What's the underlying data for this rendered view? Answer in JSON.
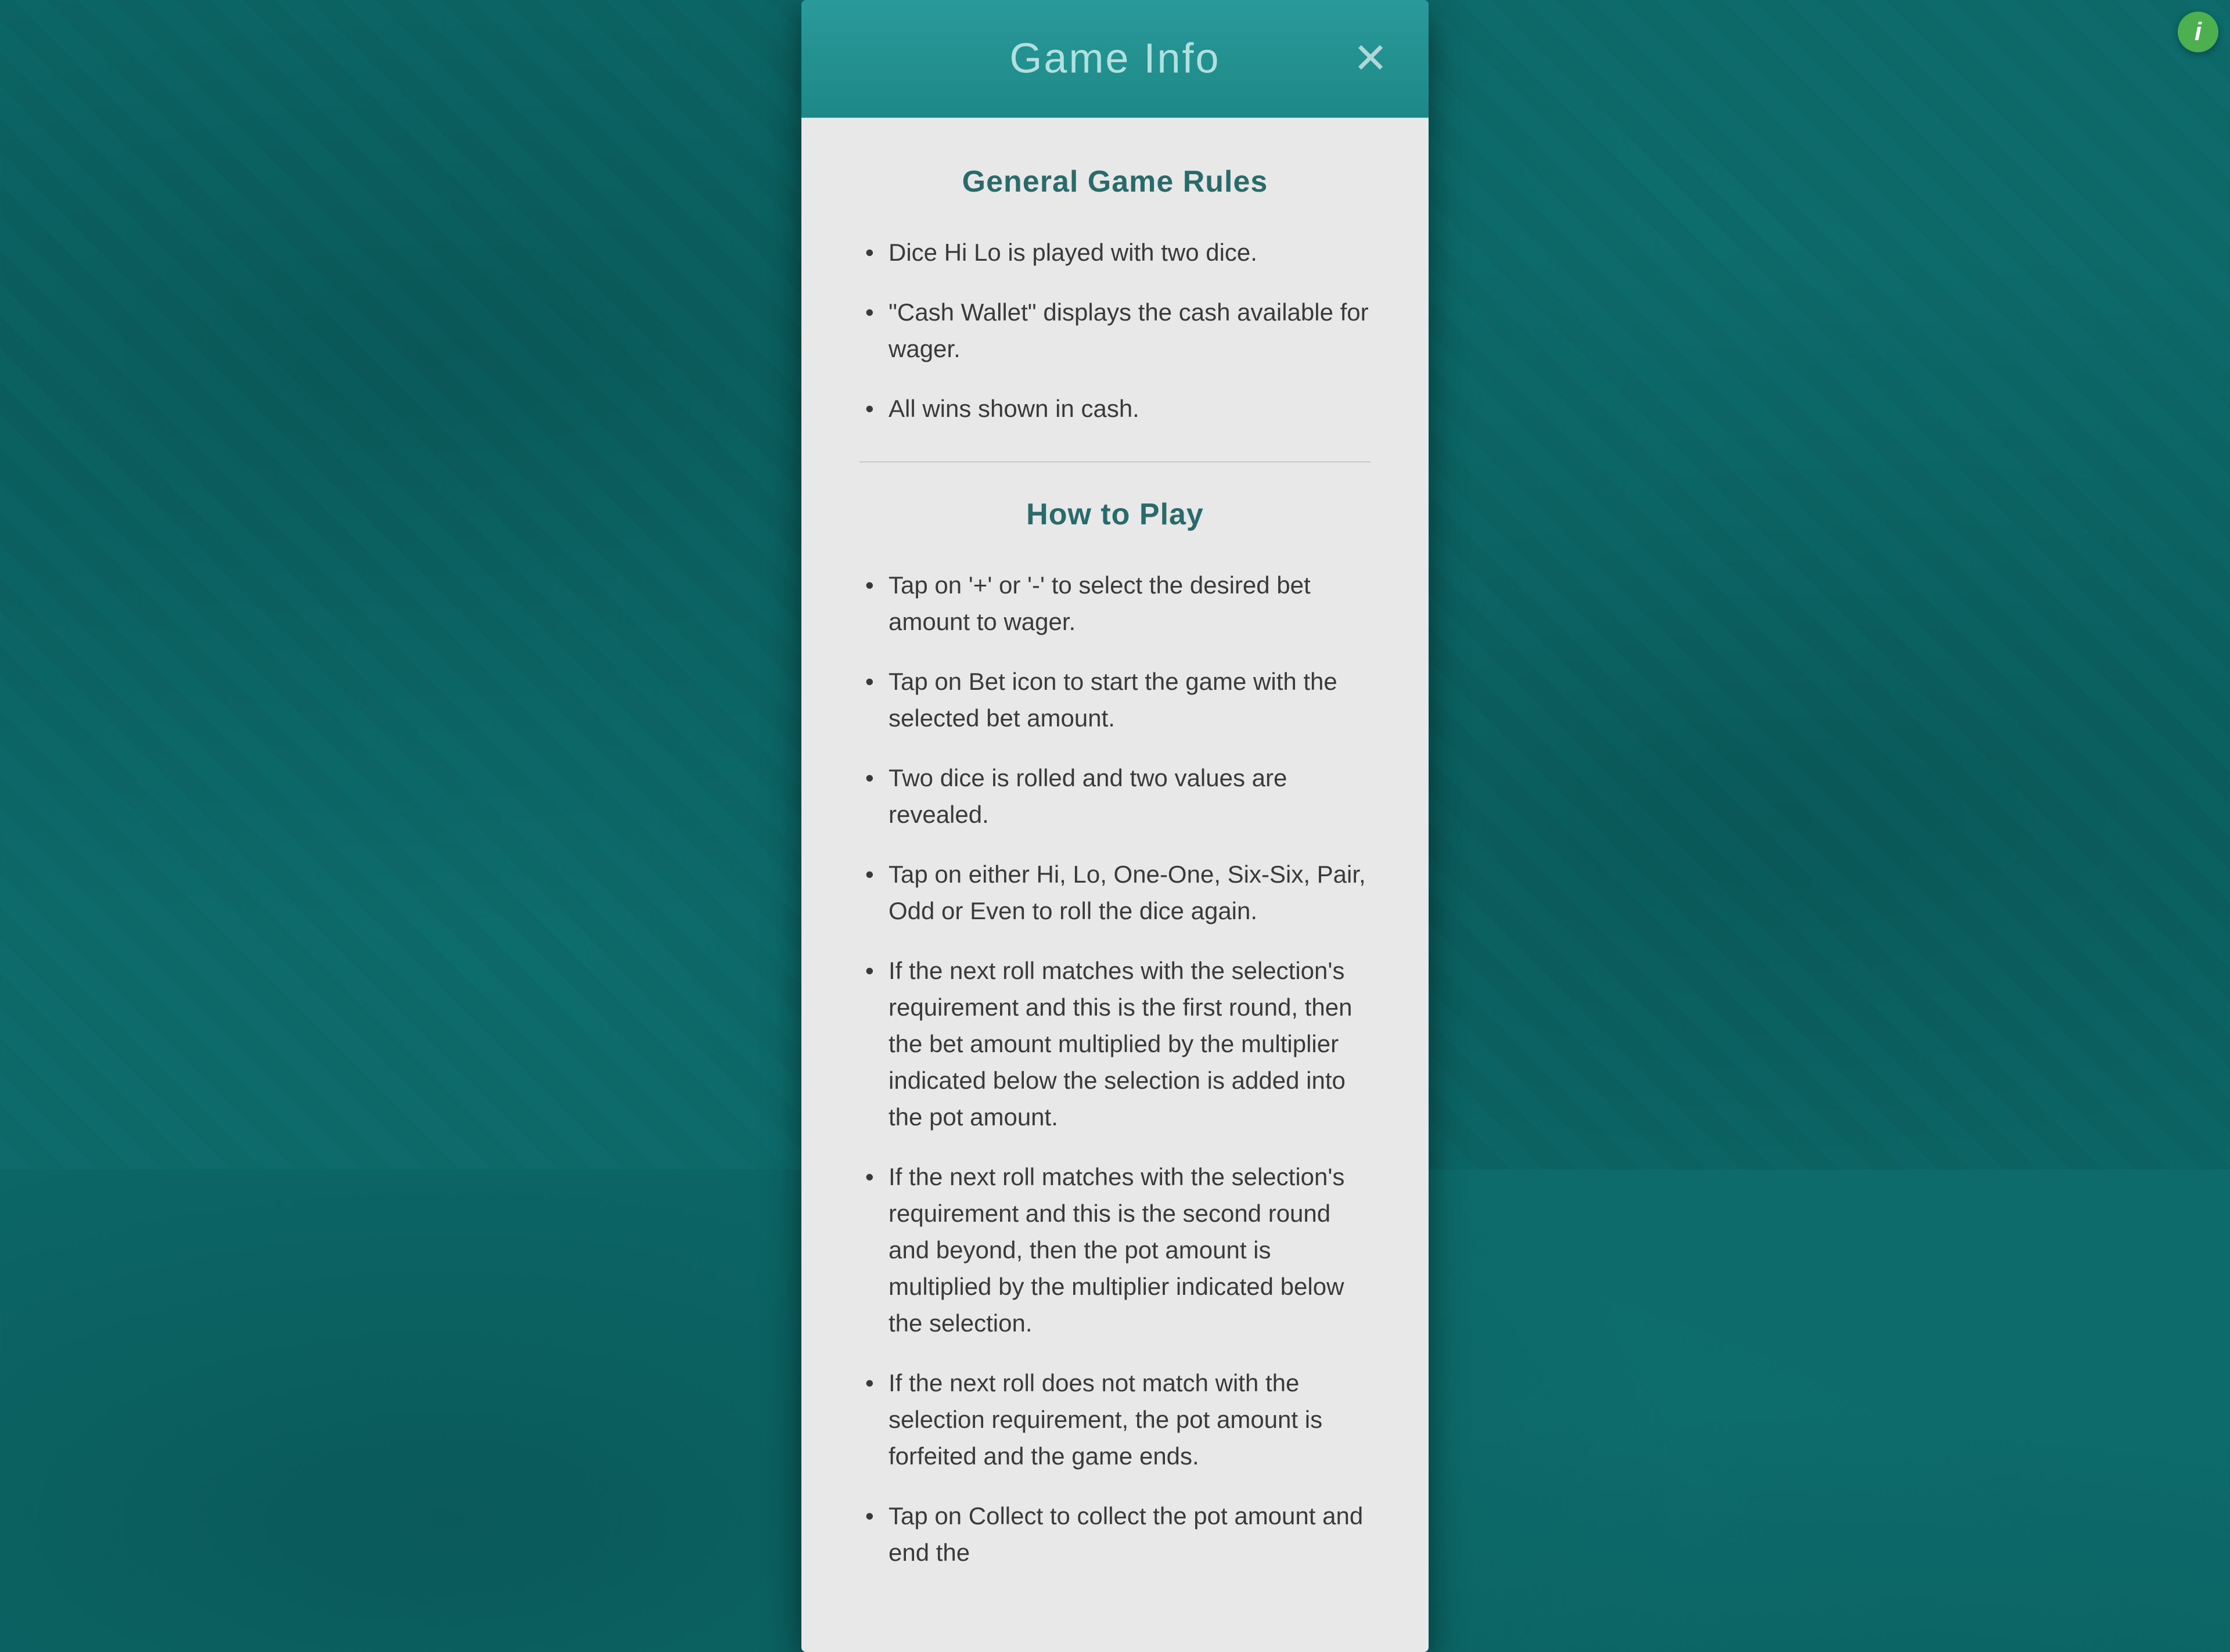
{
  "modal": {
    "title": "Game Info",
    "close_label": "✕"
  },
  "general_rules": {
    "title": "General Game Rules",
    "items": [
      "Dice Hi Lo is played with two dice.",
      "\"Cash Wallet\" displays the cash available for wager.",
      "All wins shown in cash."
    ]
  },
  "how_to_play": {
    "title": "How to Play",
    "items": [
      "Tap on '+' or '-' to select the desired bet amount to wager.",
      "Tap on Bet icon to start the game with the selected bet amount.",
      "Two dice is rolled and two values are revealed.",
      "Tap on either Hi, Lo, One-One, Six-Six, Pair, Odd or Even to roll the dice again.",
      "If the next roll matches with the selection's requirement and this is the first round, then the bet amount multiplied by the multiplier indicated below the selection is added into the pot amount.",
      "If the next roll matches with the selection's requirement and this is the second round and beyond, then the pot amount is multiplied by the multiplier indicated below the selection.",
      "If the next roll does not match with the selection requirement, the pot amount is forfeited and the game ends.",
      "Tap on Collect to collect the pot amount and end the"
    ]
  },
  "info_button": {
    "label": "i"
  }
}
